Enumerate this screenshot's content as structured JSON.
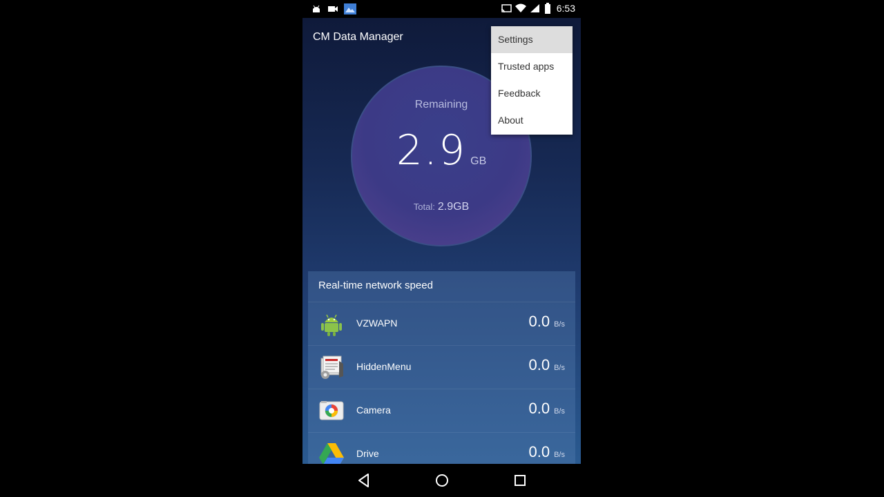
{
  "status_bar": {
    "time": "6:53",
    "left_icons": [
      "android-notif-icon",
      "video-icon",
      "photo-icon"
    ],
    "right_icons": [
      "cast-icon",
      "wifi-icon",
      "signal-icon",
      "battery-icon"
    ]
  },
  "app": {
    "title": "CM Data Manager",
    "ring": {
      "label": "Remaining",
      "value": "2.9",
      "unit": "GB",
      "total_label": "Total:",
      "total_value": "2.9GB"
    },
    "menu": {
      "items": [
        {
          "label": "Settings",
          "highlighted": true
        },
        {
          "label": "Trusted apps"
        },
        {
          "label": "Feedback"
        },
        {
          "label": "About"
        }
      ]
    },
    "speed_card": {
      "title": "Real-time network speed",
      "rows": [
        {
          "name": "VZWAPN",
          "value": "0.0",
          "unit": "B/s",
          "icon": "android-robot-icon"
        },
        {
          "name": "HiddenMenu",
          "value": "0.0",
          "unit": "B/s",
          "icon": "hidden-menu-icon"
        },
        {
          "name": "Camera",
          "value": "0.0",
          "unit": "B/s",
          "icon": "camera-icon"
        },
        {
          "name": "Drive",
          "value": "0.0",
          "unit": "B/s",
          "icon": "drive-icon"
        }
      ]
    }
  },
  "nav_bar": {
    "buttons": [
      "back-icon",
      "home-icon",
      "recents-icon"
    ]
  },
  "colors": {
    "accent_green": "#8bc34a",
    "menu_highlight": "#dddddd",
    "background": "#000000"
  }
}
